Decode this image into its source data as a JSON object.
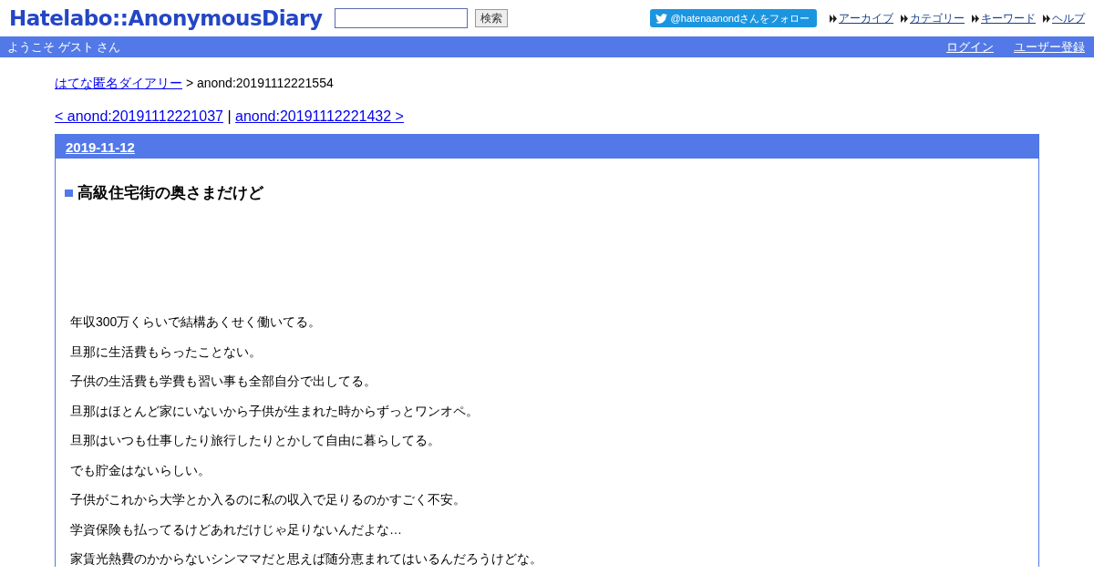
{
  "header": {
    "logo": "Hatelabo::AnonymousDiary",
    "search": {
      "button": "検索"
    },
    "follow_button": "@hatenaanondさんをフォロー",
    "links": [
      "アーカイブ",
      "カテゴリー",
      "キーワード",
      "ヘルプ"
    ]
  },
  "user_bar": {
    "welcome": "ようこそ ゲスト さん",
    "links": [
      "ログイン",
      "ユーザー登録"
    ]
  },
  "breadcrumb": {
    "link": "はてな匿名ダイアリー",
    "current": "> anond:20191112221554"
  },
  "pager": {
    "prev": "< anond:20191112221037",
    "separator": "|",
    "next": "anond:20191112221432 >"
  },
  "day": {
    "date": "2019-11-12",
    "title": "高級住宅街の奥さまだけど",
    "paragraphs": [
      "年収300万くらいで結構あくせく働いてる。",
      "旦那に生活費もらったことない。",
      "子供の生活費も学費も習い事も全部自分で出してる。",
      "旦那はほとんど家にいないから子供が生まれた時からずっとワンオペ。",
      "旦那はいつも仕事したり旅行したりとかして自由に暮らしてる。",
      "でも貯金はないらしい。",
      "子供がこれから大学とか入るのに私の収入で足りるのかすごく不安。",
      "学資保険も払ってるけどあれだけじゃ足りないんだよな…",
      "家賃光熱費のかからないシンママだと思えば随分恵まれてはいるんだろうけどな。"
    ]
  }
}
